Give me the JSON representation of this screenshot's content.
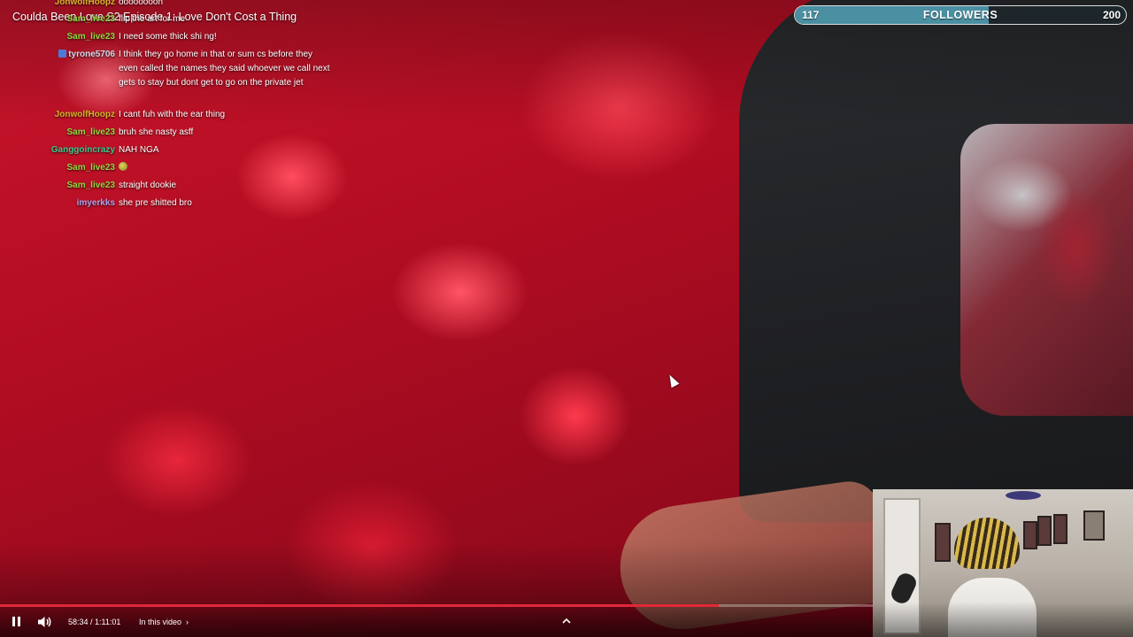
{
  "video": {
    "title": "Coulda Been Love S2 Episode 1: Love Don't Cost a Thing"
  },
  "chat": [
    {
      "user": "JonwolfHoopz",
      "color": "#d4b52a",
      "badge": false,
      "message": "oooooooon"
    },
    {
      "user": "Sam_live23",
      "color": "#8ed93e",
      "badge": false,
      "message": "flip the art for me"
    },
    {
      "user": "Sam_live23",
      "color": "#8ed93e",
      "badge": false,
      "message": "I need some thick shi ng!"
    },
    {
      "user": "tyrone5706",
      "color": "#d5dce8",
      "badge": true,
      "message": "I think they go home in that or sum cs before they even called the names they said whoever we call next gets to stay but dont get to go on the private jet"
    },
    {
      "user": "JonwolfHoopz",
      "color": "#d4b52a",
      "badge": false,
      "message": "I cant fuh with the ear thing"
    },
    {
      "user": "Sam_live23",
      "color": "#8ed93e",
      "badge": false,
      "message": "bruh she nasty asff"
    },
    {
      "user": "Ganggoincrazy",
      "color": "#39c98c",
      "badge": false,
      "message": "NAH NGA"
    },
    {
      "user": "Sam_live23",
      "color": "#8ed93e",
      "badge": false,
      "message": "",
      "emote": true
    },
    {
      "user": "Sam_live23",
      "color": "#8ed93e",
      "badge": false,
      "message": "straight dookie"
    },
    {
      "user": "imyerkks",
      "color": "#a9a4ee",
      "badge": false,
      "message": "she pre shitted bro"
    }
  ],
  "followers": {
    "current": "117",
    "label": "FOLLOWERS",
    "goal": "200",
    "progress_fraction": 0.585,
    "fill_color": "#4a8fa2"
  },
  "player": {
    "time": "58:34 / 1:11:01",
    "progress_fraction": 0.824,
    "chapters_label": "In this video",
    "accent_color": "#e0283a",
    "icons": [
      "pause-icon",
      "volume-icon",
      "chevron-right-icon",
      "chevron-up-icon"
    ]
  }
}
